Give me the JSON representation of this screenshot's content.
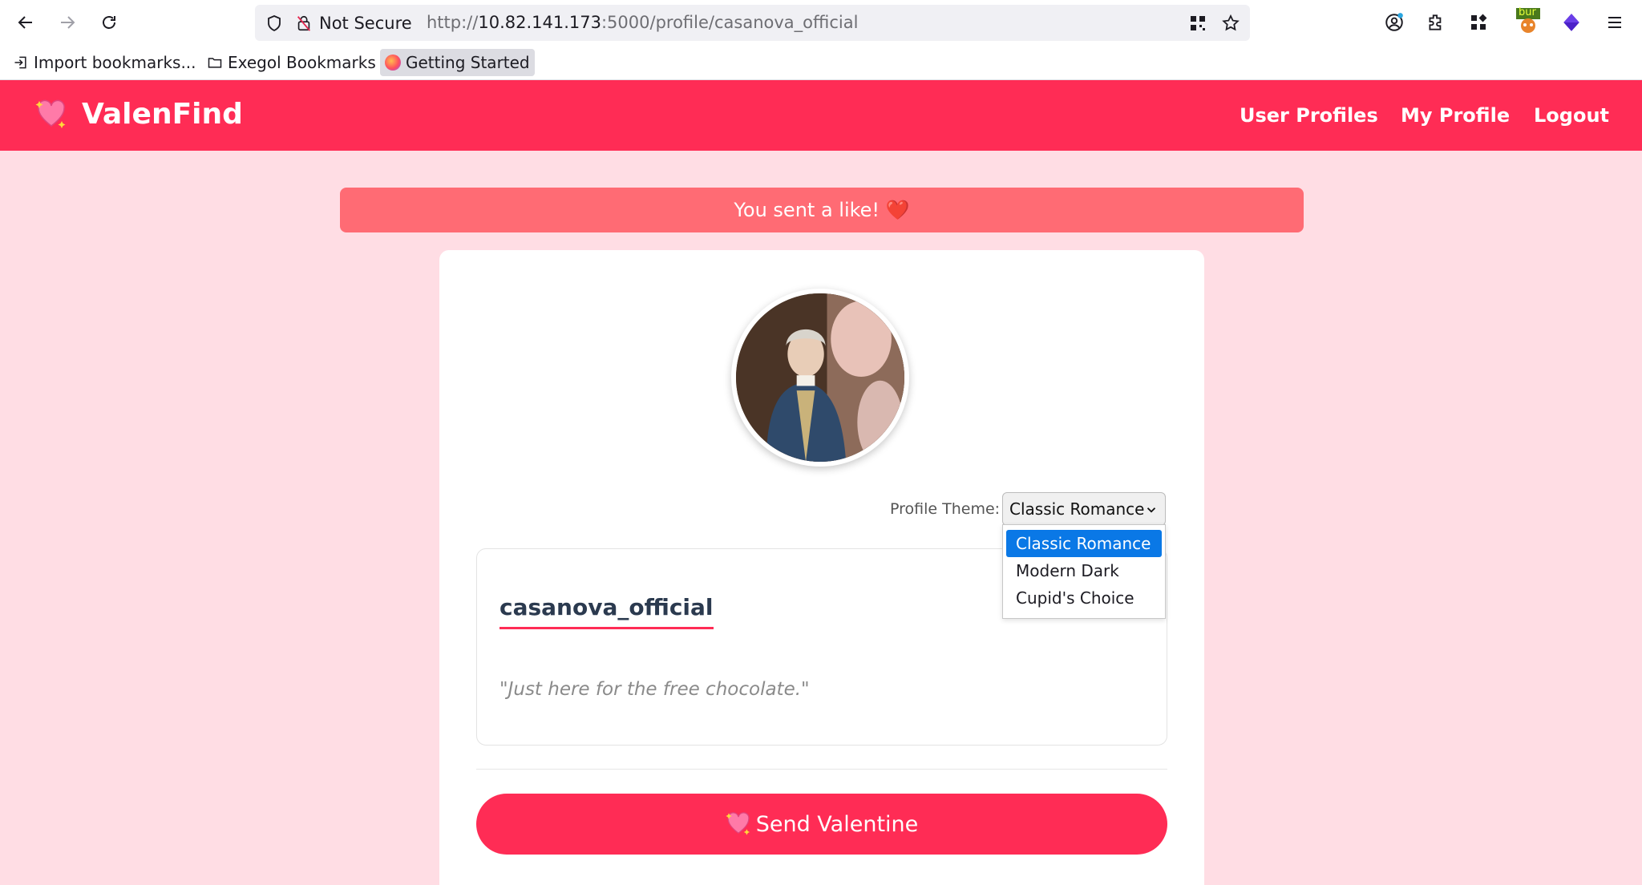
{
  "browser": {
    "not_secure_label": "Not Secure",
    "url_prefix": "http://",
    "url_host": "10.82.141.173",
    "url_rest": ":5000/profile/casanova_official",
    "ext_badge": "bur",
    "bookmarks": [
      {
        "label": "Import bookmarks..."
      },
      {
        "label": "Exegol Bookmarks"
      },
      {
        "label": "Getting Started"
      }
    ]
  },
  "app": {
    "brand": "ValenFind",
    "nav": [
      {
        "label": "User Profiles"
      },
      {
        "label": "My Profile"
      },
      {
        "label": "Logout"
      }
    ],
    "accent_color": "#ff2c55"
  },
  "alert": {
    "text": "You sent a like! ❤️"
  },
  "profile": {
    "theme_label": "Profile Theme:",
    "theme_selected": "Classic Romance",
    "theme_options": [
      "Classic Romance",
      "Modern Dark",
      "Cupid's Choice"
    ],
    "username": "casanova_official",
    "bio": "\"Just here for the free chocolate.\"",
    "send_label": "Send Valentine"
  }
}
